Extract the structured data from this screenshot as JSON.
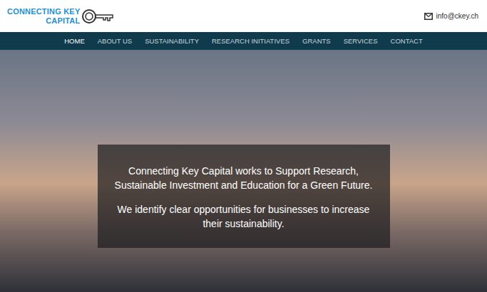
{
  "header": {
    "logo_lines": [
      "CONNECTING KEY",
      "CAPITAL"
    ],
    "email": "info@ckey.ch"
  },
  "nav": {
    "items": [
      {
        "label": "HOME",
        "selected": true
      },
      {
        "label": "ABOUT US",
        "selected": false
      },
      {
        "label": "SUSTAINABILITY",
        "selected": false
      },
      {
        "label": "RESEARCH INITIATIVES",
        "selected": false
      },
      {
        "label": "GRANTS",
        "selected": false
      },
      {
        "label": "SERVICES",
        "selected": false
      },
      {
        "label": "CONTACT",
        "selected": false
      }
    ]
  },
  "hero": {
    "paragraphs": [
      [
        "Connecting Key Capital works to Support Research,",
        "Sustainable Investment and Education for a Green Future."
      ],
      [
        "We identify clear opportunities for businesses to increase",
        "their sustainability."
      ]
    ]
  }
}
